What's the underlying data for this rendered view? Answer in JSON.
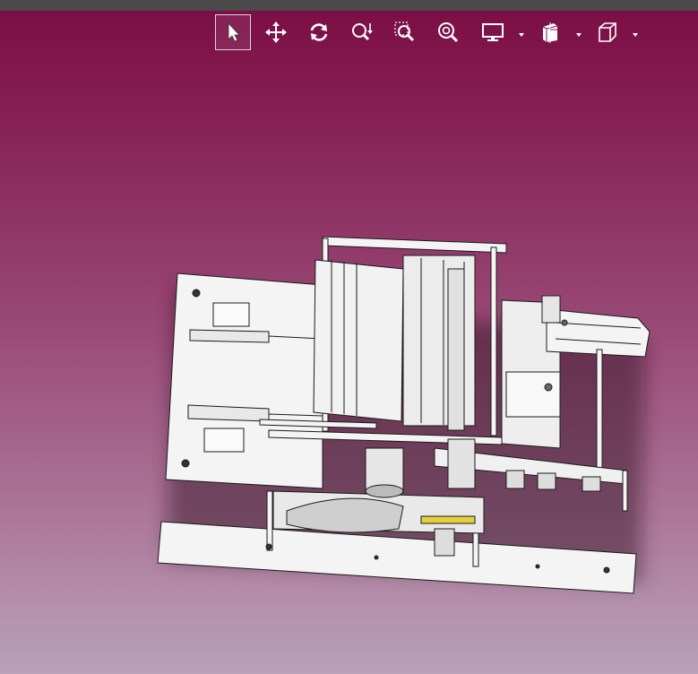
{
  "toolbar": {
    "tools": [
      {
        "name": "select",
        "icon": "cursor-arrow-icon",
        "active": true
      },
      {
        "name": "pan",
        "icon": "move-arrows-icon",
        "active": false
      },
      {
        "name": "rotate",
        "icon": "rotate-icon",
        "active": false
      },
      {
        "name": "zoom-in-out",
        "icon": "zoom-in-out-icon",
        "active": false
      },
      {
        "name": "zoom-to-area",
        "icon": "zoom-area-icon",
        "active": false
      },
      {
        "name": "zoom-to-fit",
        "icon": "zoom-fit-icon",
        "active": false
      },
      {
        "name": "display-style",
        "icon": "monitor-icon",
        "active": false,
        "dropdown": true
      },
      {
        "name": "section-view",
        "icon": "section-view-icon",
        "active": false,
        "dropdown": true
      },
      {
        "name": "view-orientation",
        "icon": "cube-view-icon",
        "active": false,
        "dropdown": true
      }
    ]
  },
  "viewport": {
    "background_top": "#7a0c44",
    "background_bottom": "#b9a2ba",
    "model": "assembly-machine-3d-model"
  }
}
